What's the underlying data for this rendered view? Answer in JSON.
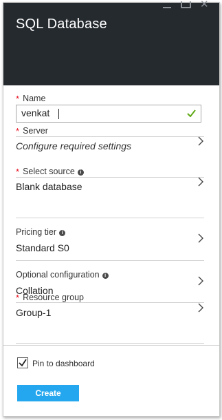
{
  "blade": {
    "title": "SQL Database",
    "window_controls": [
      "minimize-icon",
      "maximize-icon",
      "close-icon"
    ]
  },
  "form": {
    "required_marker": "*",
    "name": {
      "label": "Name",
      "value": "venkat",
      "valid": true
    },
    "server": {
      "label": "Server",
      "value": "Configure required settings"
    },
    "select_source": {
      "label": "Select source",
      "value": "Blank database"
    },
    "pricing_tier": {
      "label": "Pricing tier",
      "value": "Standard S0"
    },
    "optional_configuration": {
      "label": "Optional configuration",
      "value": "Collation"
    },
    "resource_group": {
      "label": "Resource group",
      "value": "Group-1"
    }
  },
  "footer": {
    "pin_label": "Pin to dashboard",
    "pin_checked": true,
    "create_label": "Create"
  },
  "colors": {
    "header_bg": "#252a2f",
    "required": "#e81123",
    "valid_check": "#5ea814",
    "create_button": "#24a7ee"
  }
}
